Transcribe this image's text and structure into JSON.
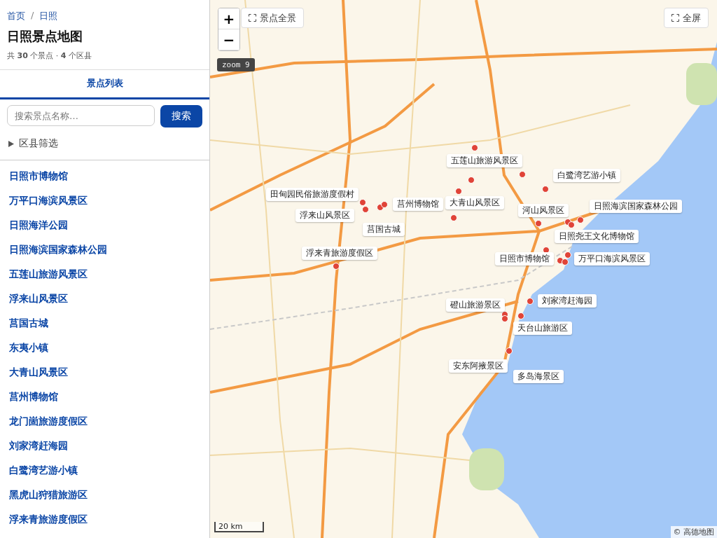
{
  "sidebar": {
    "breadcrumb": [
      {
        "label": "首页"
      },
      {
        "label": "日照"
      }
    ],
    "breadcrumb_separator": "/",
    "title": "日照景点地图",
    "summary": "共 **30** 个景点 · **4** 个区县",
    "tabs": [
      {
        "label": "景点列表",
        "selected": true
      }
    ],
    "search": {
      "placeholder": "搜索景点名称…",
      "button": "搜索"
    },
    "filter": {
      "label": "区县筛选",
      "expanded": false
    },
    "items": [
      {
        "name": "日照市博物馆"
      },
      {
        "name": "万平口海滨风景区"
      },
      {
        "name": "日照海洋公园"
      },
      {
        "name": "日照海滨国家森林公园"
      },
      {
        "name": "五莲山旅游风景区"
      },
      {
        "name": "浮来山风景区"
      },
      {
        "name": "莒国古城"
      },
      {
        "name": "东夷小镇"
      },
      {
        "name": "大青山风景区"
      },
      {
        "name": "莒州博物馆"
      },
      {
        "name": "龙门崮旅游度假区"
      },
      {
        "name": "刘家湾赶海园"
      },
      {
        "name": "白鹭湾艺游小镇"
      },
      {
        "name": "黑虎山狩猎旅游区"
      },
      {
        "name": "浮来青旅游度假区"
      }
    ]
  },
  "map": {
    "zoom_in": "+",
    "zoom_out": "−",
    "overview_button": "景点全景",
    "fullscreen_button": "全屏",
    "zoom_badge": "zoom 9",
    "scale": "20 km",
    "attribution": "© 高德地图",
    "labels": [
      {
        "text": "五莲山旅游风景区"
      },
      {
        "text": "白鹭湾艺游小镇"
      },
      {
        "text": "田甸园民俗旅游度假村"
      },
      {
        "text": "莒州博物馆"
      },
      {
        "text": "日照海滨国家森林公园"
      },
      {
        "text": "大青山风景区"
      },
      {
        "text": "浮来山风景区"
      },
      {
        "text": "河山风景区"
      },
      {
        "text": "莒国古城"
      },
      {
        "text": "日照尧王文化博物馆"
      },
      {
        "text": "浮来青旅游度假区"
      },
      {
        "text": "日照市博物馆"
      },
      {
        "text": "万平口海滨风景区"
      },
      {
        "text": "刘家湾赶海园"
      },
      {
        "text": "磴山旅游景区"
      },
      {
        "text": "天台山旅游区"
      },
      {
        "text": "安东阿掖景区"
      },
      {
        "text": "多岛海景区"
      }
    ]
  }
}
